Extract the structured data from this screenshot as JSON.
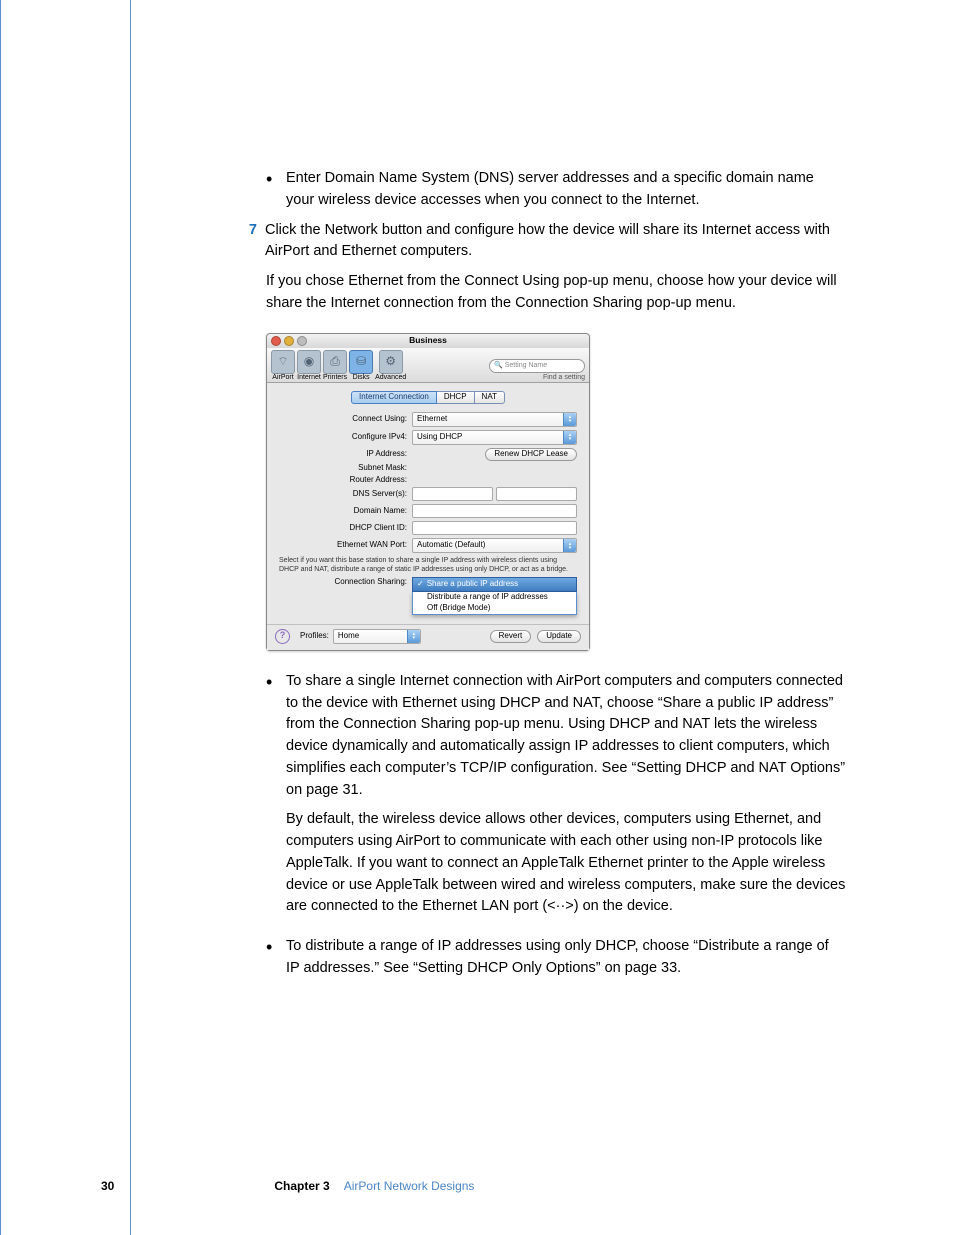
{
  "body": {
    "bullet_dns": "Enter Domain Name System (DNS) server addresses and a specific domain name your wireless device accesses when you connect to the Internet.",
    "step7_num": "7",
    "step7": "Click the Network button and configure how the device will share its Internet access with AirPort and Ethernet computers.",
    "para_ethernet": "If you chose Ethernet from the Connect Using pop-up menu, choose how your device will share the Internet connection from the Connection Sharing pop-up menu.",
    "bullet_share": "To share a single Internet connection with AirPort computers and computers connected to the device with Ethernet using DHCP and NAT, choose “Share a public IP address” from the Connection Sharing pop-up menu. Using DHCP and NAT lets the wireless device dynamically and automatically assign IP addresses to client computers, which simplifies each computer’s TCP/IP configuration. See “Setting DHCP and NAT Options” on page 31.",
    "para_default_a": "By default, the wireless device allows other devices, computers using Ethernet, and computers using AirPort to communicate with each other using non-IP protocols like AppleTalk. If you want to connect an AppleTalk Ethernet printer to the Apple wireless device or use AppleTalk between wired and wireless computers, make sure the devices are connected to the Ethernet LAN port (",
    "para_default_b": ") on the device.",
    "bullet_distribute": "To distribute a range of IP addresses using only DHCP, choose “Distribute a range of IP addresses.” See “Setting DHCP Only Options” on page 33."
  },
  "ss": {
    "title": "Business",
    "toolbar": [
      "AirPort",
      "Internet",
      "Printers",
      "Disks",
      "Advanced"
    ],
    "search_placeholder": "Setting Name",
    "search_hint": "Find a setting",
    "tabs": [
      "Internet Connection",
      "DHCP",
      "NAT"
    ],
    "fields": {
      "connect_using": {
        "label": "Connect Using:",
        "value": "Ethernet"
      },
      "configure_ipv4": {
        "label": "Configure IPv4:",
        "value": "Using DHCP"
      },
      "ip_address": {
        "label": "IP Address:",
        "button": "Renew DHCP Lease"
      },
      "subnet_mask": {
        "label": "Subnet Mask:"
      },
      "router_address": {
        "label": "Router Address:"
      },
      "dns_servers": {
        "label": "DNS Server(s):"
      },
      "domain_name": {
        "label": "Domain Name:"
      },
      "dhcp_client_id": {
        "label": "DHCP Client ID:"
      },
      "ethernet_wan_port": {
        "label": "Ethernet WAN Port:",
        "value": "Automatic (Default)"
      },
      "connection_sharing": {
        "label": "Connection Sharing:",
        "options": [
          "Share a public IP address",
          "Distribute a range of IP addresses",
          "Off (Bridge Mode)"
        ]
      }
    },
    "help_text": "Select if you want this base station to share a single IP address with wireless clients using DHCP and NAT, distribute a range of static IP addresses using only DHCP, or act as a bridge.",
    "footer": {
      "profiles_label": "Profiles:",
      "profiles_value": "Home",
      "revert": "Revert",
      "update": "Update"
    }
  },
  "footer": {
    "page": "30",
    "chapter": "Chapter 3",
    "title": "AirPort Network Designs"
  }
}
